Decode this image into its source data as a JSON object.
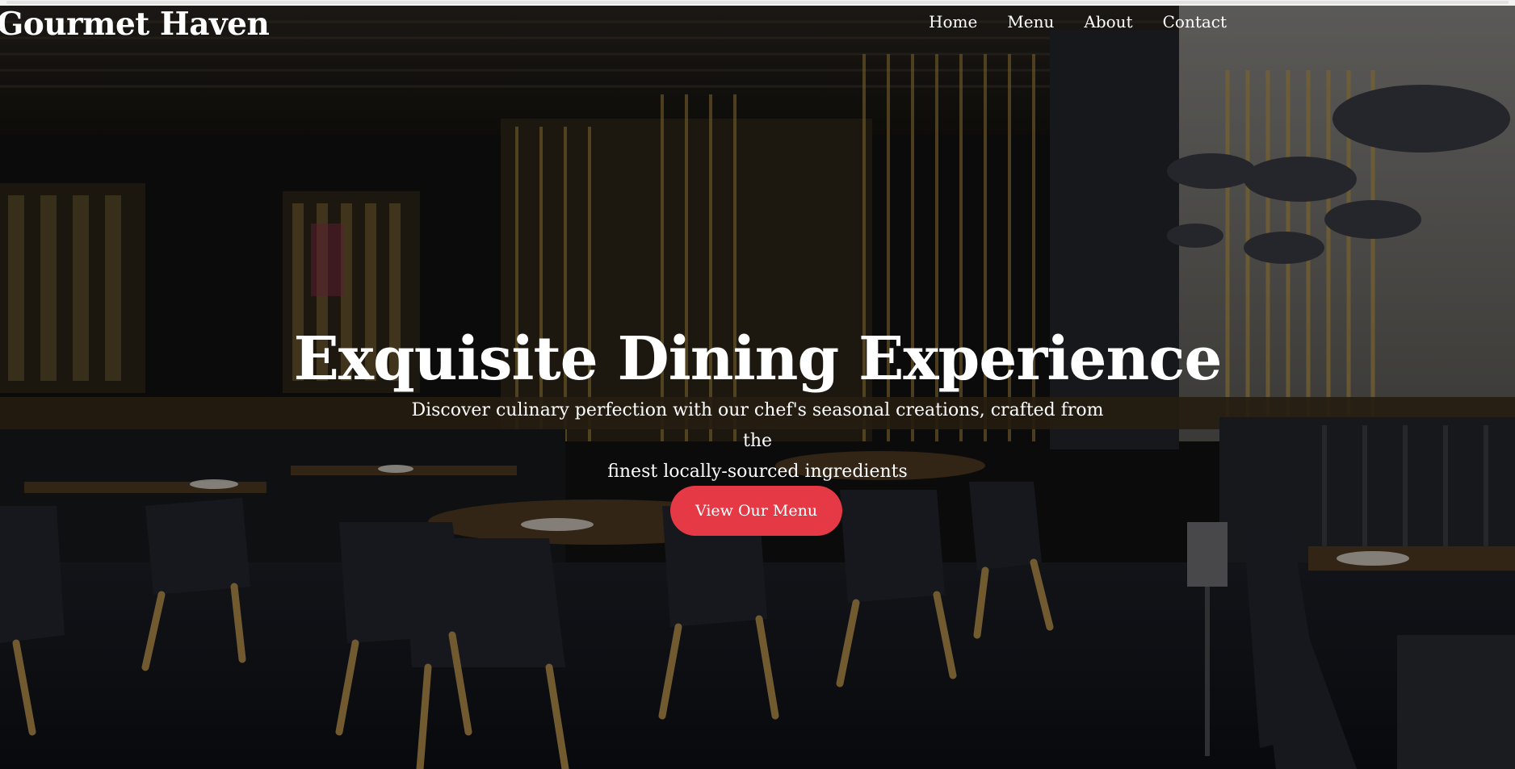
{
  "header": {
    "logo": "Gourmet Haven",
    "nav": [
      "Home",
      "Menu",
      "About",
      "Contact"
    ]
  },
  "hero": {
    "title": "Exquisite Dining Experience",
    "subtitle_line1": "Discover culinary perfection with our chef's seasonal creations, crafted from the",
    "subtitle_line2": "finest locally-sourced ingredients",
    "cta_label": "View Our Menu"
  },
  "colors": {
    "accent": "#e63946",
    "text": "#ffffff",
    "overlay": "#000000"
  }
}
